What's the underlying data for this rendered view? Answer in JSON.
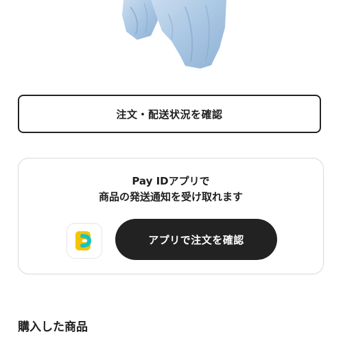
{
  "product": {
    "image_icon": "shirt-photo"
  },
  "order": {
    "status_button_label": "注文・配送状況を確認"
  },
  "promo": {
    "line1": "Pay IDアプリで",
    "line2": "商品の発送通知を受け取れます",
    "app_icon": "pay-id-app-icon",
    "app_button_label": "アプリで注文を確認"
  },
  "purchased": {
    "section_title": "購入した商品"
  },
  "colors": {
    "button_dark": "#222222",
    "app_icon_yellow": "#f5c400",
    "app_icon_teal": "#19c3c3"
  }
}
